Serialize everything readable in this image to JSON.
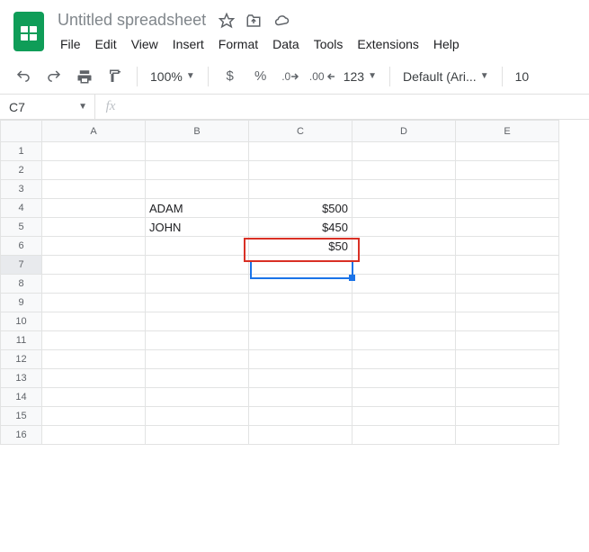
{
  "doc_title": "Untitled spreadsheet",
  "menu": [
    "File",
    "Edit",
    "View",
    "Insert",
    "Format",
    "Data",
    "Tools",
    "Extensions",
    "Help"
  ],
  "toolbar": {
    "zoom": "100%",
    "currency": "$",
    "percent": "%",
    "dec_dec": ".0",
    "inc_dec": ".00",
    "more_formats": "123",
    "font": "Default (Ari...",
    "font_size": "10"
  },
  "namebox": "C7",
  "formula": "",
  "columns": [
    "A",
    "B",
    "C",
    "D",
    "E"
  ],
  "row_count": 16,
  "cells": {
    "B4": "ADAM",
    "C4": "$500",
    "B5": "JOHN",
    "C5": "$450",
    "C6": "$50"
  },
  "active_cell": "C7",
  "highlight_cell": "C6"
}
